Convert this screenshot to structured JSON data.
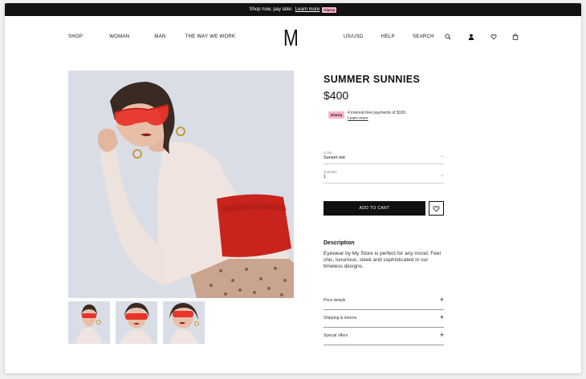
{
  "announcement": {
    "text": "Shop now, pay later.",
    "link": "Learn more",
    "badge": "Klarna"
  },
  "header": {
    "nav_left": [
      "SHOP",
      "WOMAN",
      "MAN",
      "THE WAY WE WORK"
    ],
    "logo": "M",
    "nav_right": [
      "US/USD",
      "HELP",
      "SEARCH"
    ],
    "icons": [
      "search-icon",
      "account-icon",
      "wishlist-icon",
      "bag-icon"
    ]
  },
  "product": {
    "title": "SUMMER SUNNIES",
    "price": "$400",
    "klarna": {
      "badge": "Klarna",
      "text": "4 interest-free payments of $100.",
      "link": "Learn more"
    },
    "color": {
      "label": "Color",
      "value": "Sunset red"
    },
    "quantity": {
      "label": "Quantity",
      "value": "1"
    },
    "add_to_cart": "ADD TO CART",
    "description_title": "Description",
    "description": "Eyewear by My Store is perfect for any mood. Feel chic, luxurious, sleek and sophisticated in our timeless designs.",
    "accordions": [
      "Price details",
      "Shipping & returns",
      "Special offers"
    ]
  },
  "colors": {
    "accent": "#111111",
    "klarna_pink": "#ffb3c7",
    "lens_red": "#e8342a",
    "top_red": "#c8241d"
  }
}
